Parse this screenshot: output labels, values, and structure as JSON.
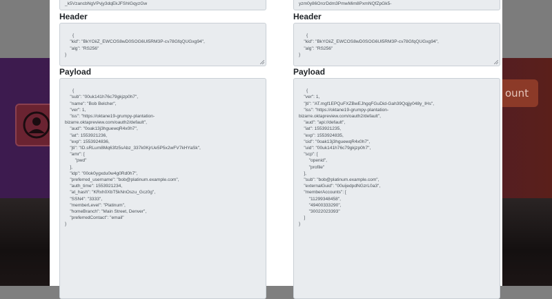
{
  "background": {
    "button_label": "ount"
  },
  "left": {
    "signature_tail": "_k5VzancbNgVPvjy3dqEkJFShIGqyzGw",
    "header_label": "Header",
    "header_text": "{\n    \"kid\": \"BkYOiiZ_EWCOS8wD0SOG6Ul5RM3P-cv78GfqQUGxg94\",\n    \"alg\": \"RS256\"\n}",
    "payload_label": "Payload",
    "payload_text": "{\n    \"sub\": \"00uk141h76c79gkjzp0h7\",\n    \"name\": \"Bob Belcher\",\n    \"ver\": 1,\n    \"iss\": \"https://oktane19-grumpy-plantation-\nbizarre.oktapreview.com/oauth2/default\",\n    \"aud\": \"0oak13j3hguewqR4x0h7\",\n    \"iat\": 1553921236,\n    \"exp\": 1553924836,\n    \"jti\": \"ID.sRLum8Mq63fz5sAbz_337k0KjrUe5P5x2wFV7kHYaSk\",\n    \"amr\": [\n        \"pwd\"\n    ],\n    \"idp\": \"00ok0ygxdu0w4g0Rd0h7\",\n    \"preferred_username\": \"bob@platinum.example.com\",\n    \"auth_time\": 1553921234,\n    \"at_hash\": \"KRxh0XbT5kNnOszu_Gcz0g\",\n    \"SSN4\": \"3333\",\n    \"memberLevel\": \"Platinum\",\n    \"homeBranch\": \"Main Street, Denver\",\n    \"preferredContact\": \"email\"\n}"
  },
  "right": {
    "signature_tail": "yzm0y86OrcrDdm3PmwMim8PxmNQfZpGk5-",
    "header_label": "Header",
    "header_text": "{\n    \"kid\": \"BkYOiiZ_EWCOS8wD0SOG6Ul5RM3P-cv78GfqQUGxg94\",\n    \"alg\": \"RS256\"\n}",
    "payload_label": "Payload",
    "payload_text": "{\n    \"ver\": 1,\n    \"jti\": \"AT.mgf1EPQuFXZBwEJhgqFGuDid-Gah39Qqjjy048y_IHs\",\n    \"iss\": \"https://oktane19-grumpy-plantation-\nbizarre.oktapreview.com/oauth2/default\",\n    \"aud\": \"api://default\",\n    \"iat\": 1553921235,\n    \"exp\": 1553924835,\n    \"cid\": \"0oak13j3hguewqR4x0h7\",\n    \"uid\": \"00uk141h76c79gkjzp0h7\",\n    \"scp\": [\n        \"openid\",\n        \"profile\"\n    ],\n    \"sub\": \"bob@platinum.example.com\",\n    \"externalGuid\": \"00uijedpdNGzrL0a3\",\n    \"memberAccounts\": [\n        \"11299348458\",\n        \"49400333290\",\n        \"30022023393\"\n    ]\n}"
  }
}
